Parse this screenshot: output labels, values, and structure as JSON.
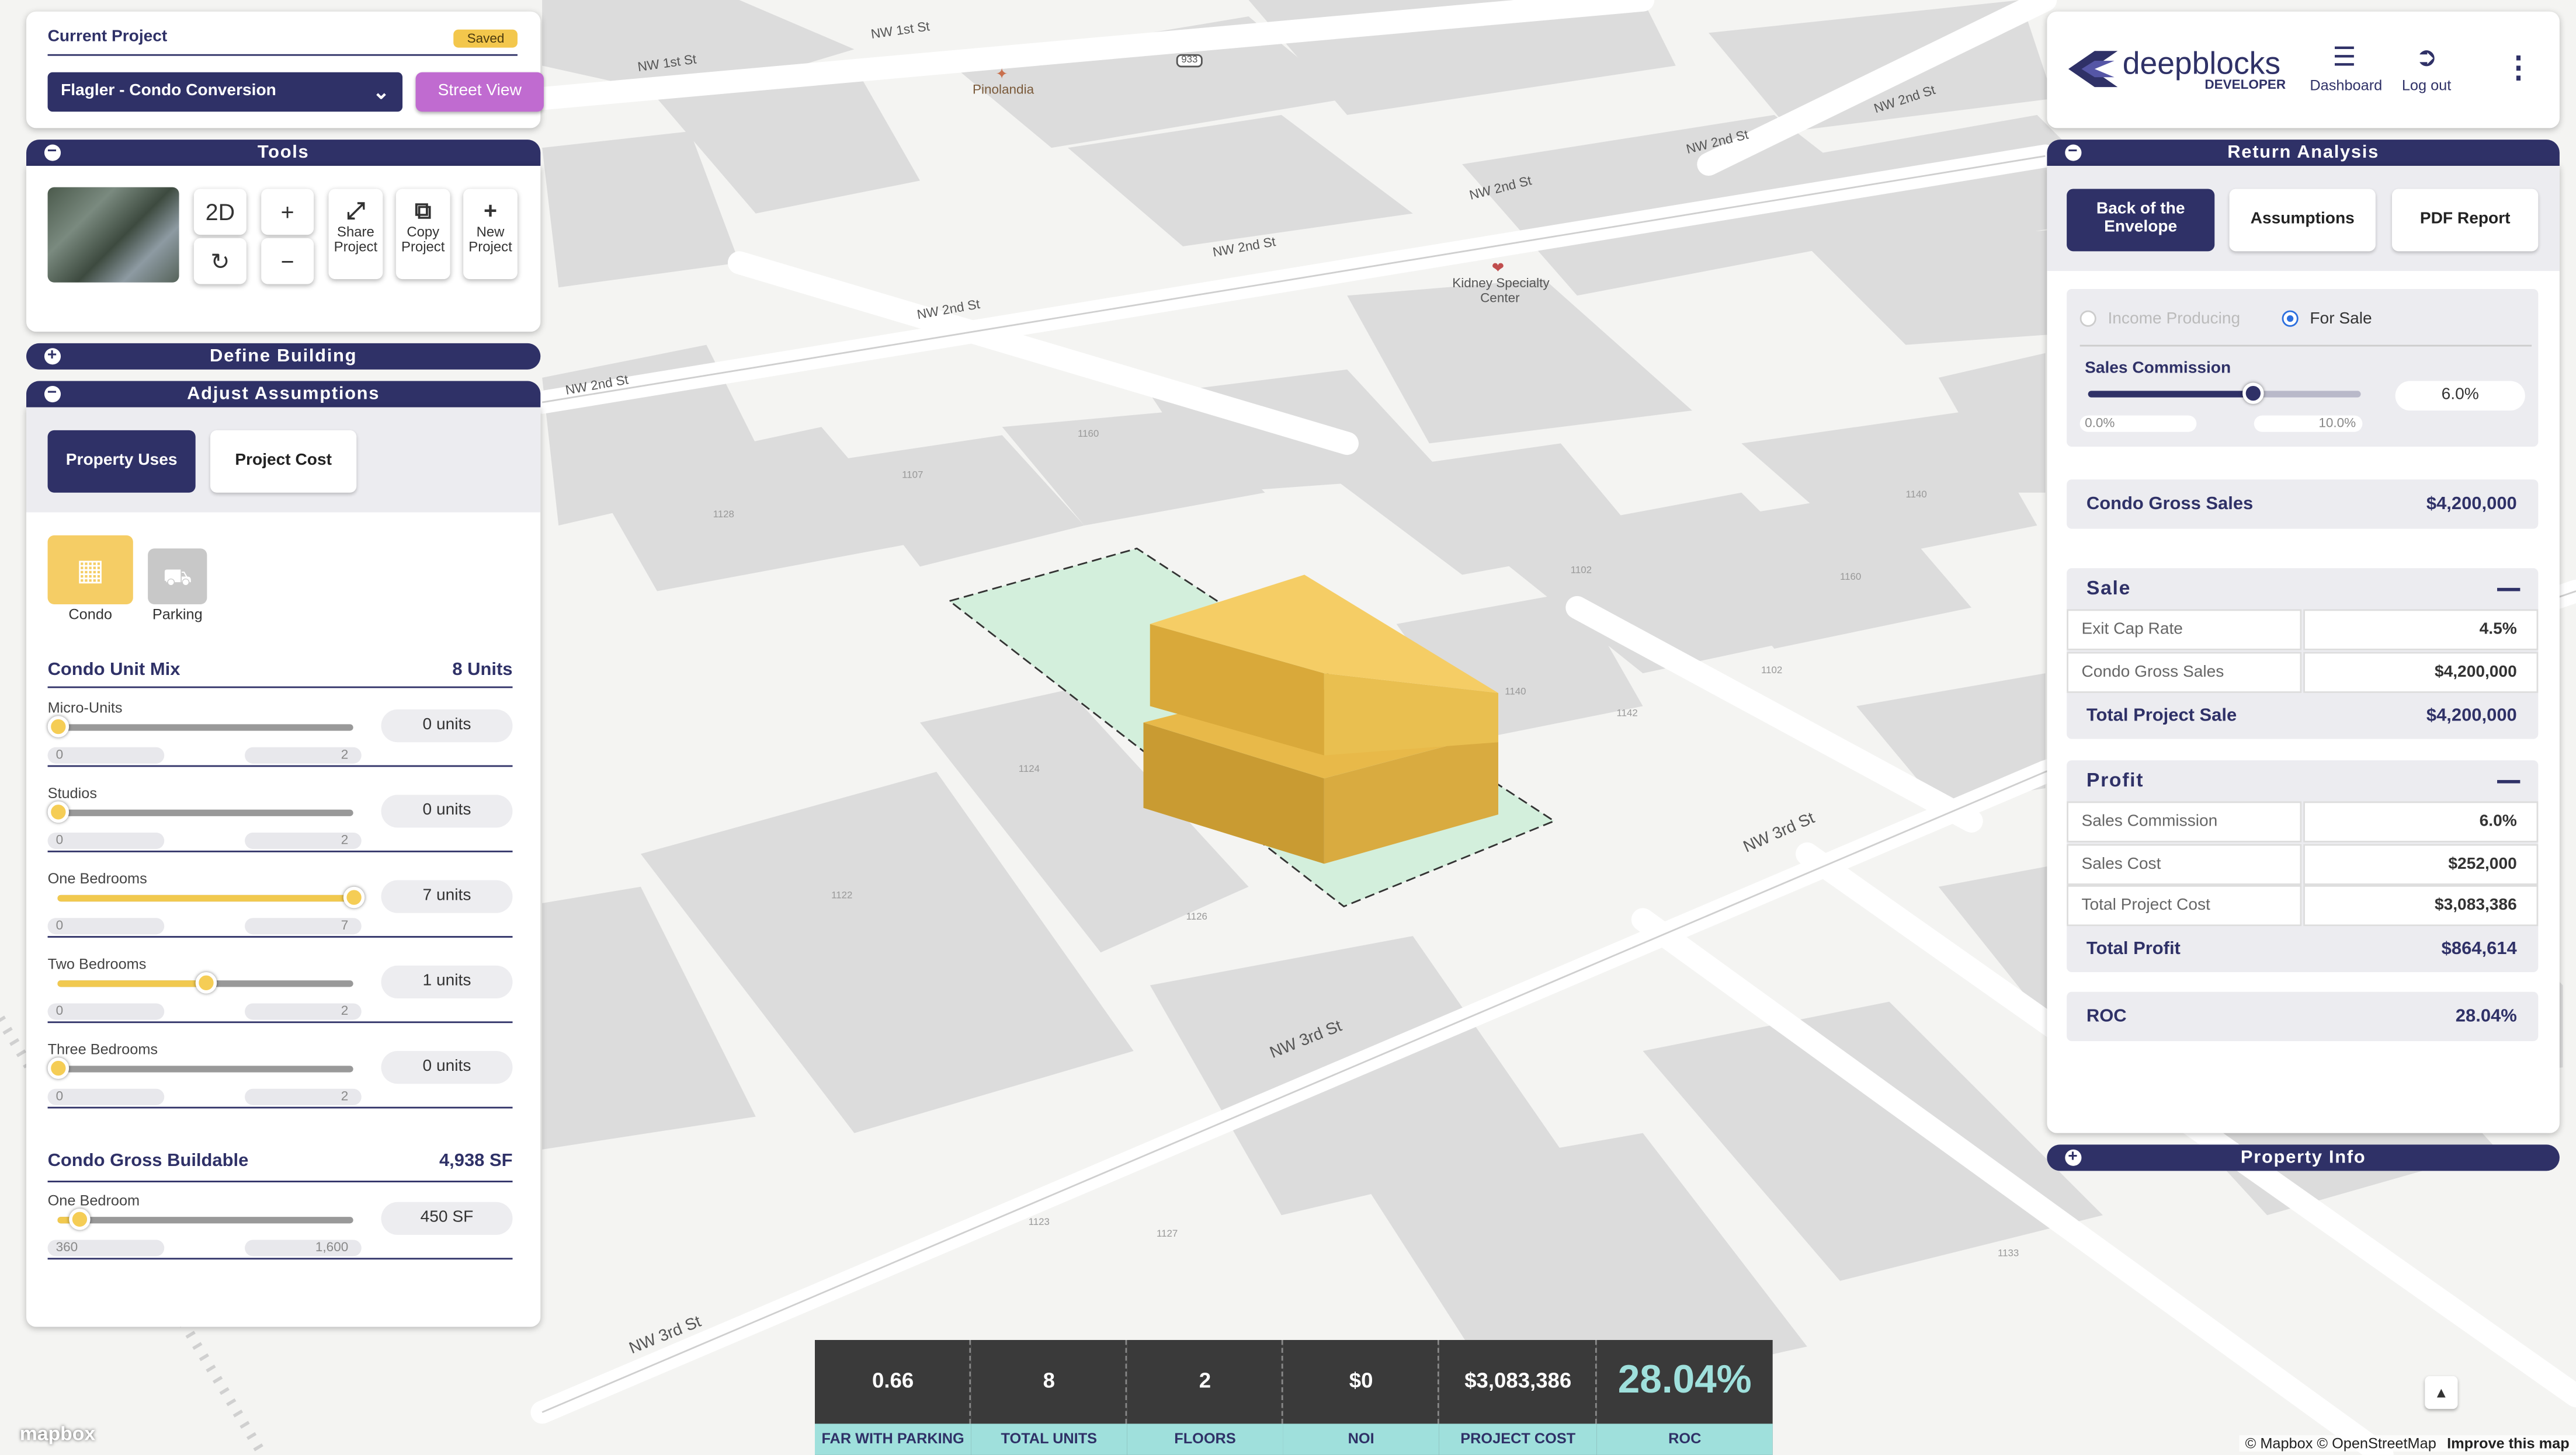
{
  "project": {
    "heading": "Current Project",
    "status": "Saved",
    "selected": "Flagler - Condo Conversion",
    "street_view": "Street View"
  },
  "tools": {
    "title": "Tools",
    "mode_2d": "2D",
    "share": [
      "Share",
      "Project"
    ],
    "copy": [
      "Copy",
      "Project"
    ],
    "new": [
      "New",
      "Project"
    ]
  },
  "sections": {
    "define_building": "Define Building",
    "adjust_assumptions": "Adjust Assumptions",
    "property_info": "Property Info"
  },
  "assumption_tabs": [
    "Property Uses",
    "Project Cost"
  ],
  "uses": [
    "Condo",
    "Parking"
  ],
  "unit_mix": {
    "title": "Condo Unit Mix",
    "total": "8 Units",
    "rows": [
      {
        "label": "Micro-Units",
        "min": "0",
        "max": "2",
        "value": "0 units",
        "fraction": 0
      },
      {
        "label": "Studios",
        "min": "0",
        "max": "2",
        "value": "0 units",
        "fraction": 0
      },
      {
        "label": "One Bedrooms",
        "min": "0",
        "max": "7",
        "value": "7 units",
        "fraction": 1
      },
      {
        "label": "Two Bedrooms",
        "min": "0",
        "max": "2",
        "value": "1 units",
        "fraction": 0.5
      },
      {
        "label": "Three Bedrooms",
        "min": "0",
        "max": "2",
        "value": "0 units",
        "fraction": 0
      }
    ]
  },
  "gross_buildable": {
    "title": "Condo Gross Buildable",
    "total": "4,938 SF",
    "rows": [
      {
        "label": "One Bedroom",
        "min": "360",
        "max": "1,600",
        "value": "450 SF",
        "fraction": 0.07
      }
    ]
  },
  "header": {
    "brand": "deepblocks",
    "sub": "DEVELOPER",
    "dashboard": "Dashboard",
    "logout": "Log out"
  },
  "return_analysis": {
    "title": "Return Analysis",
    "tabs": [
      "Back of the Envelope",
      "Assumptions",
      "PDF Report"
    ],
    "radio_income": "Income Producing",
    "radio_sale": "For Sale",
    "commission_label": "Sales Commission",
    "commission_value": "6.0%",
    "commission_fraction": 0.6,
    "commission_min": "0.0%",
    "commission_max": "10.0%",
    "gross_sales_label": "Condo Gross Sales",
    "gross_sales_value": "$4,200,000",
    "sale": {
      "title": "Sale",
      "rows": [
        {
          "k": "Exit Cap Rate",
          "v": "4.5%"
        },
        {
          "k": "Condo Gross Sales",
          "v": "$4,200,000"
        }
      ],
      "total_label": "Total Project Sale",
      "total_value": "$4,200,000"
    },
    "profit": {
      "title": "Profit",
      "rows": [
        {
          "k": "Sales Commission",
          "v": "6.0%"
        },
        {
          "k": "Sales Cost",
          "v": "$252,000"
        },
        {
          "k": "Total Project Cost",
          "v": "$3,083,386"
        }
      ],
      "total_label": "Total Profit",
      "total_value": "$864,614"
    },
    "roc_label": "ROC",
    "roc_value": "28.04%"
  },
  "kpis": [
    {
      "value": "0.66",
      "label": "FAR WITH PARKING"
    },
    {
      "value": "8",
      "label": "TOTAL UNITS"
    },
    {
      "value": "2",
      "label": "FLOORS"
    },
    {
      "value": "$0",
      "label": "NOI"
    },
    {
      "value": "$3,083,386",
      "label": "PROJECT COST"
    },
    {
      "value": "28.04%",
      "label": "ROC"
    }
  ],
  "map_labels": {
    "streets": [
      "NW 1st St",
      "NW 1st St",
      "NW 2nd St",
      "NW 2nd St",
      "NW 2nd St",
      "NW 2nd St",
      "NW 2nd St",
      "NW 2nd St",
      "NW 3rd St",
      "NW 3rd St",
      "NW 3rd St"
    ],
    "pois": [
      "Pinolandia",
      "Kidney Specialty",
      "Center"
    ],
    "shield": "933",
    "numbers": [
      "1128",
      "1126",
      "1124",
      "1122",
      "1123",
      "1127",
      "1133",
      "1140",
      "1142",
      "1160",
      "1102",
      "1107",
      "1160",
      "1102",
      "1140"
    ]
  },
  "attribution": {
    "logo": "mapbox",
    "text": "© Mapbox © OpenStreetMap",
    "improve": "Improve this map"
  },
  "colors": {
    "navy": "#2f3167",
    "accent_purple": "#c06bd0",
    "gold": "#f5cd55",
    "teal_label": "#9fe0dc",
    "roc_teal": "#9fe0dc"
  }
}
